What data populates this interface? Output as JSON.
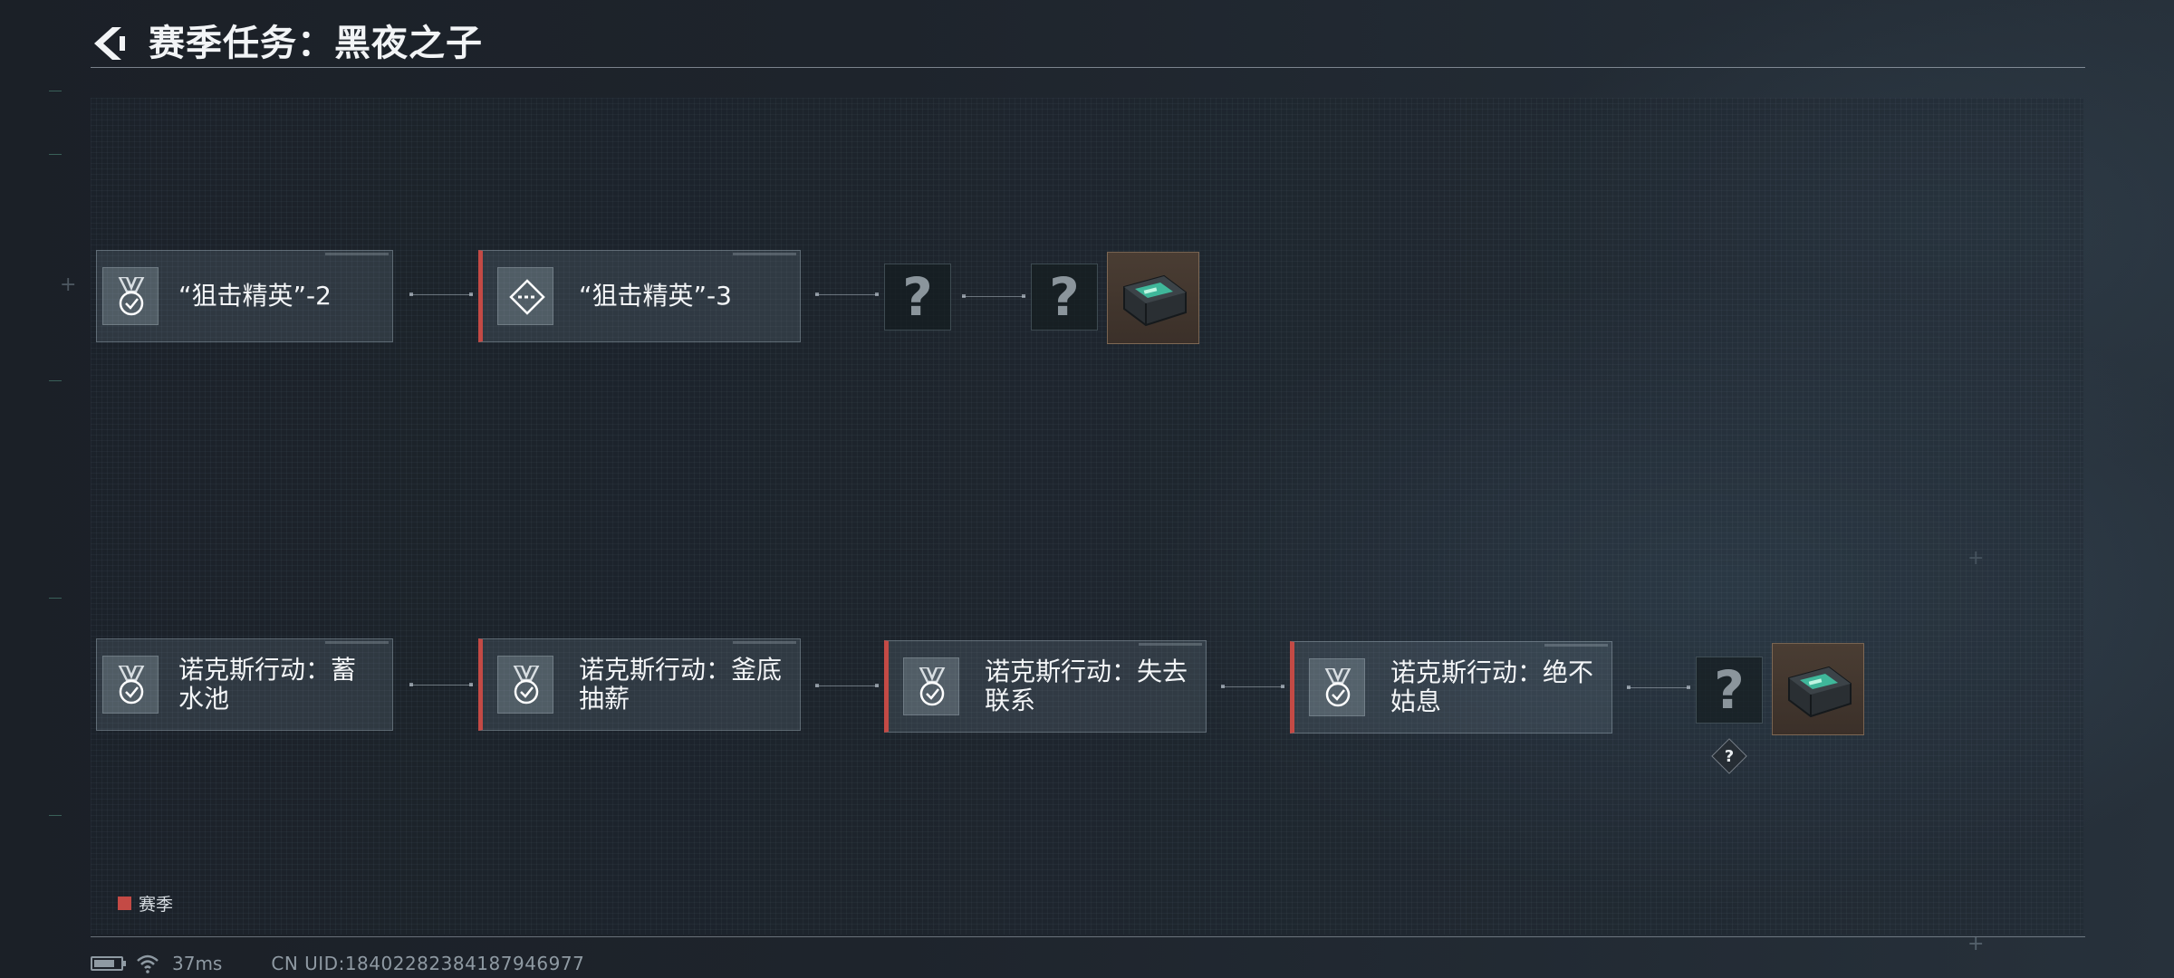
{
  "header": {
    "back_icon": "back-arrow-icon",
    "title": "赛季任务：黑夜之子"
  },
  "chain_top": {
    "tasks": [
      {
        "label": "“狙击精英”-2",
        "season": false,
        "icon": "medal-check-icon"
      },
      {
        "label": "“狙击精英”-3",
        "season": true,
        "icon": "diamond-target-icon"
      }
    ],
    "unknowns": [
      "?",
      "?"
    ],
    "reward_icon": "case-reward-icon"
  },
  "chain_bottom": {
    "tasks": [
      {
        "label": "诺克斯行动：蓄水池",
        "season": false,
        "icon": "medal-check-icon"
      },
      {
        "label": "诺克斯行动：釜底抽薪",
        "season": true,
        "icon": "medal-check-icon"
      },
      {
        "label": "诺克斯行动：失去联系",
        "season": true,
        "icon": "medal-check-icon"
      },
      {
        "label": "诺克斯行动：绝不姑息",
        "season": true,
        "icon": "medal-check-icon"
      }
    ],
    "unknowns": [
      "?"
    ],
    "hint": "?",
    "reward_icon": "case-reward-icon"
  },
  "legend": {
    "label": "赛季",
    "color": "#c44a45"
  },
  "status": {
    "battery_icon": "battery-icon",
    "wifi_icon": "wifi-icon",
    "ping": "37ms",
    "uid": "CN UID:18402282384187946977"
  }
}
